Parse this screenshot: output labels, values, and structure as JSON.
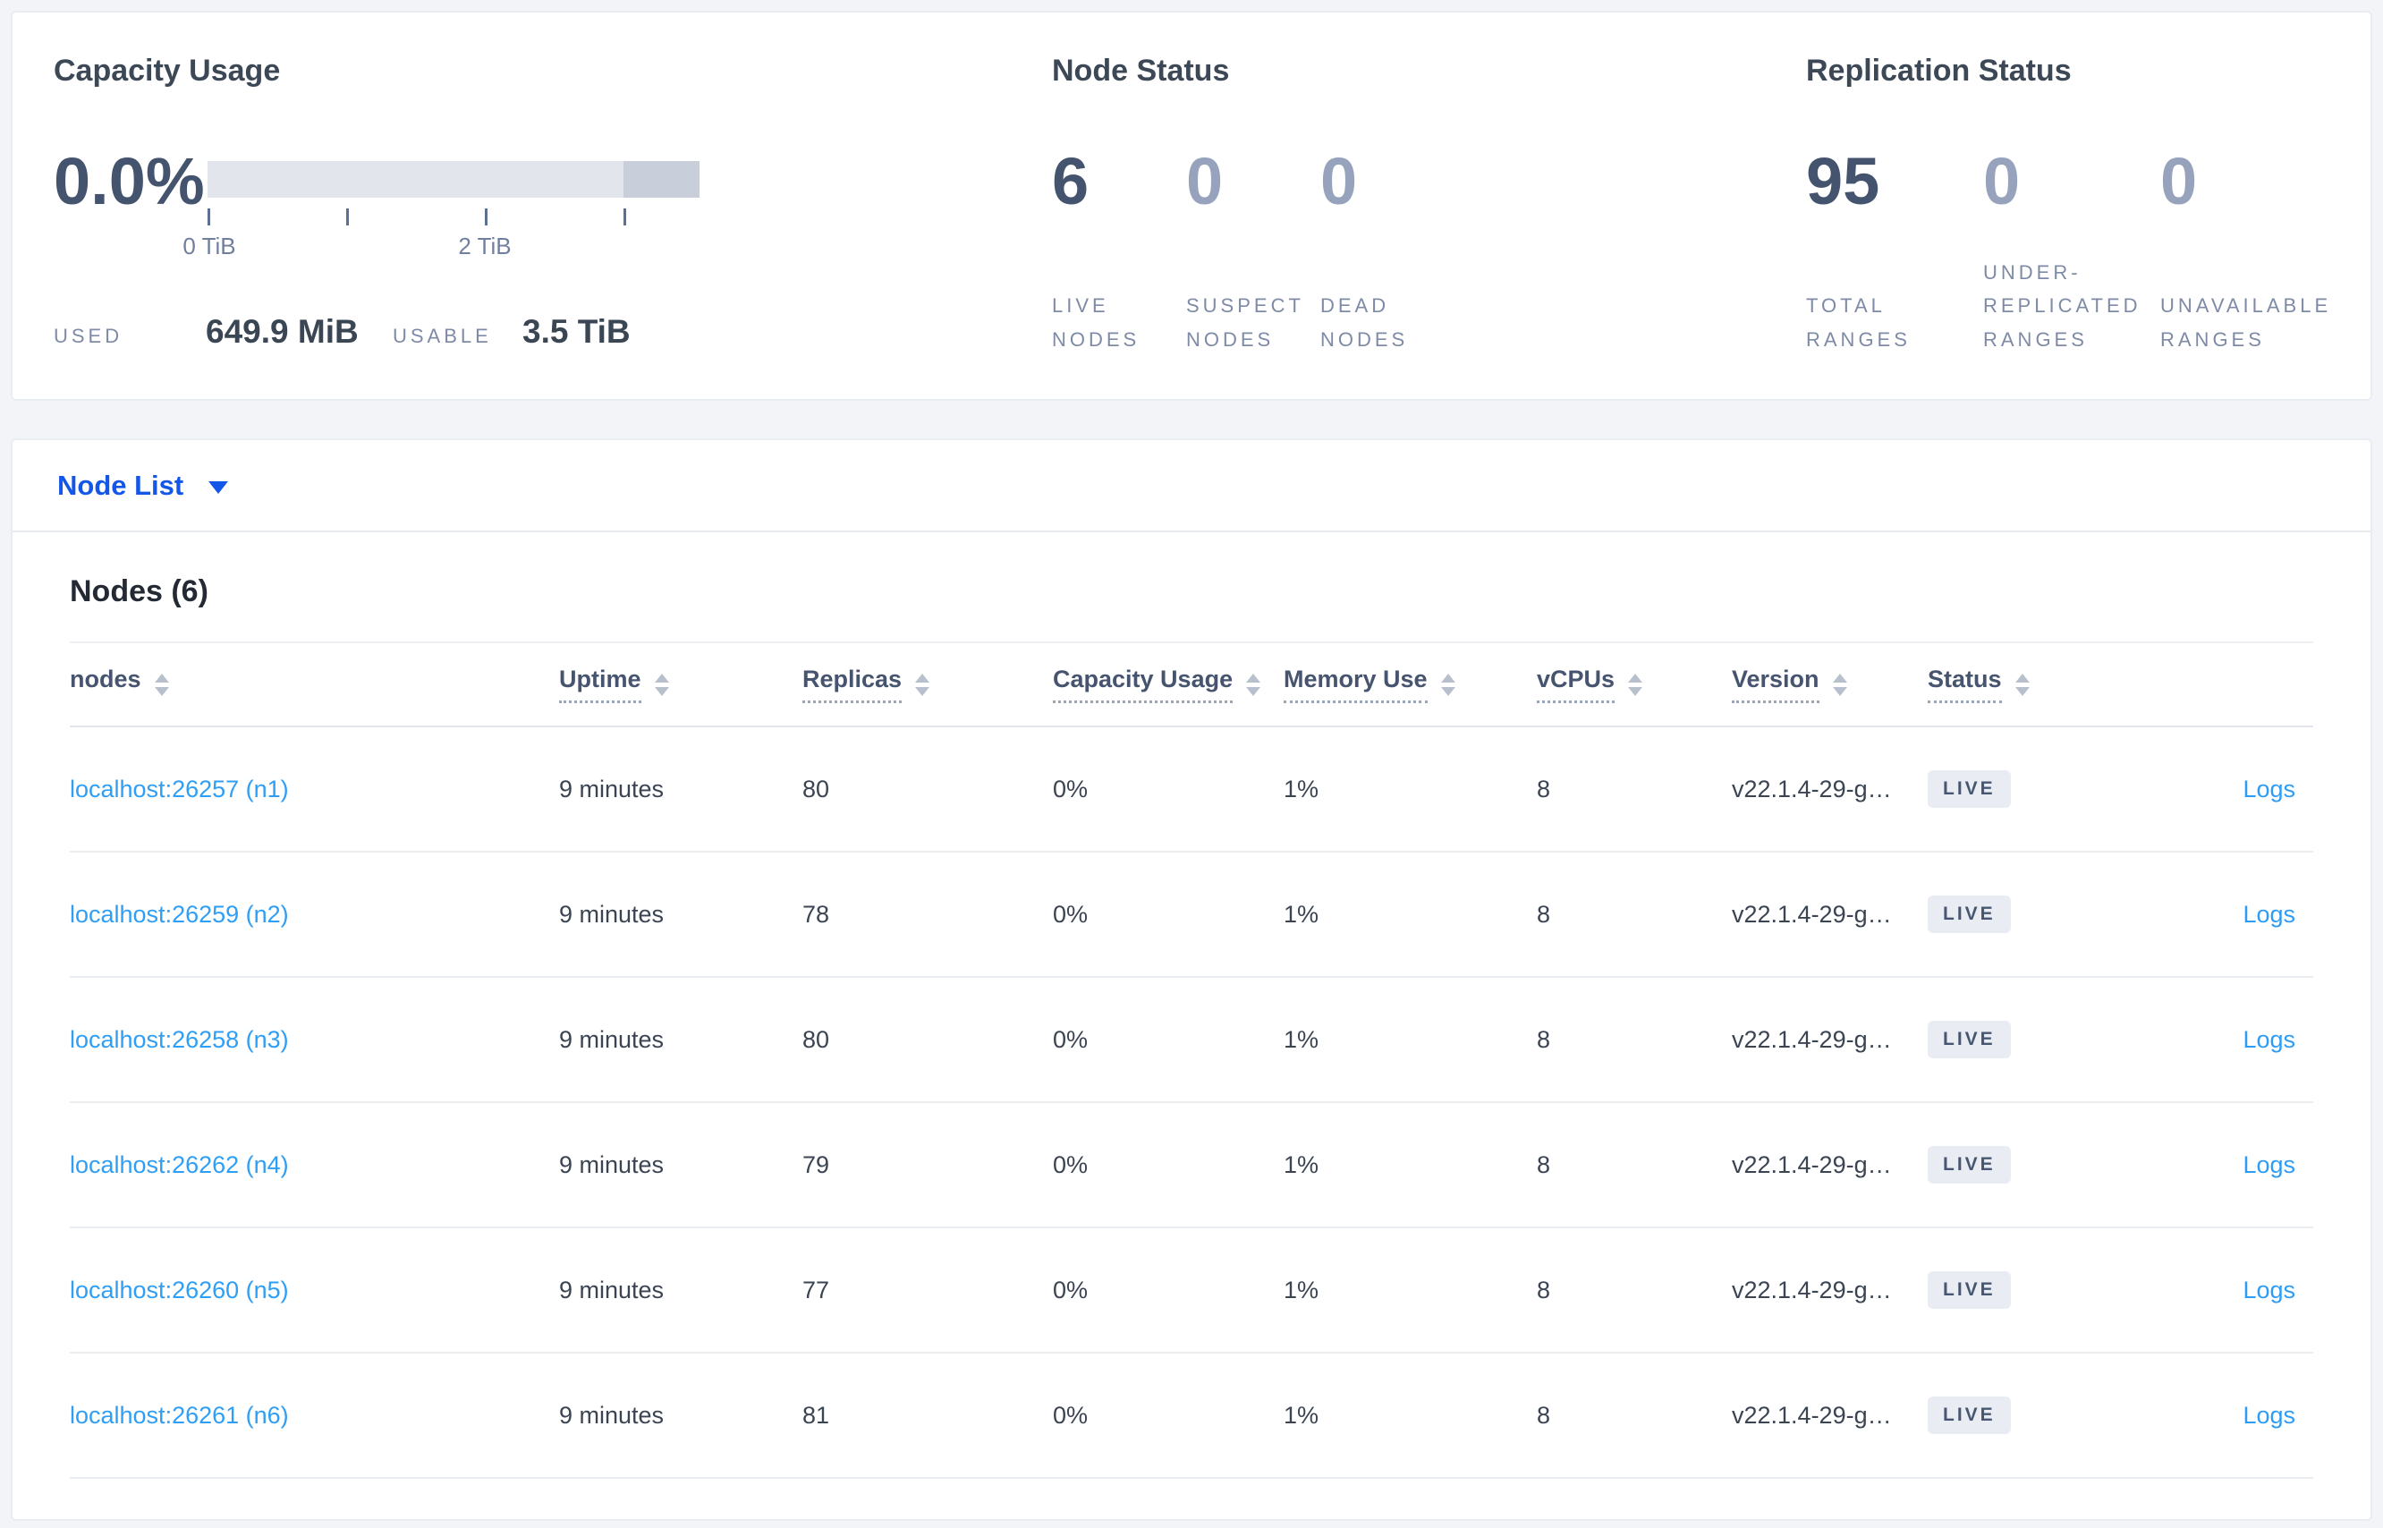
{
  "summary": {
    "capacity": {
      "title": "Capacity Usage",
      "percent": "0.0%",
      "used_label": "USED",
      "used_value": "649.9 MiB",
      "usable_label": "USABLE",
      "usable_value": "3.5 TiB",
      "bar": {
        "tick_labels": [
          "0 TiB",
          "2 TiB"
        ],
        "axis_max": "3.5 TiB",
        "light_color": "#e3e5ec",
        "dark_color": "#c9cedb"
      }
    },
    "node_status": {
      "title": "Node Status",
      "stats": [
        {
          "value": "6",
          "label": "LIVE NODES"
        },
        {
          "value": "0",
          "label": "SUSPECT NODES"
        },
        {
          "value": "0",
          "label": "DEAD NODES"
        }
      ]
    },
    "replication": {
      "title": "Replication Status",
      "stats": [
        {
          "value": "95",
          "label": "TOTAL RANGES"
        },
        {
          "value": "0",
          "label": "UNDER-REPLICATED RANGES"
        },
        {
          "value": "0",
          "label": "UNAVAILABLE RANGES"
        }
      ]
    }
  },
  "node_list": {
    "dropdown_label": "Node List",
    "heading": "Nodes (6)",
    "columns": [
      {
        "label": "nodes",
        "underline": false
      },
      {
        "label": "Uptime",
        "underline": true
      },
      {
        "label": "Replicas",
        "underline": true
      },
      {
        "label": "Capacity Usage",
        "underline": true
      },
      {
        "label": "Memory Use",
        "underline": true
      },
      {
        "label": "vCPUs",
        "underline": true
      },
      {
        "label": "Version",
        "underline": true
      },
      {
        "label": "Status",
        "underline": true
      },
      {
        "label": "",
        "underline": false
      }
    ],
    "rows": [
      {
        "node": "localhost:26257 (n1)",
        "uptime": "9 minutes",
        "replicas": "80",
        "capacity": "0%",
        "memory": "1%",
        "vcpus": "8",
        "version": "v22.1.4-29-g…",
        "status": "LIVE",
        "logs": "Logs"
      },
      {
        "node": "localhost:26259 (n2)",
        "uptime": "9 minutes",
        "replicas": "78",
        "capacity": "0%",
        "memory": "1%",
        "vcpus": "8",
        "version": "v22.1.4-29-g…",
        "status": "LIVE",
        "logs": "Logs"
      },
      {
        "node": "localhost:26258 (n3)",
        "uptime": "9 minutes",
        "replicas": "80",
        "capacity": "0%",
        "memory": "1%",
        "vcpus": "8",
        "version": "v22.1.4-29-g…",
        "status": "LIVE",
        "logs": "Logs"
      },
      {
        "node": "localhost:26262 (n4)",
        "uptime": "9 minutes",
        "replicas": "79",
        "capacity": "0%",
        "memory": "1%",
        "vcpus": "8",
        "version": "v22.1.4-29-g…",
        "status": "LIVE",
        "logs": "Logs"
      },
      {
        "node": "localhost:26260 (n5)",
        "uptime": "9 minutes",
        "replicas": "77",
        "capacity": "0%",
        "memory": "1%",
        "vcpus": "8",
        "version": "v22.1.4-29-g…",
        "status": "LIVE",
        "logs": "Logs"
      },
      {
        "node": "localhost:26261 (n6)",
        "uptime": "9 minutes",
        "replicas": "81",
        "capacity": "0%",
        "memory": "1%",
        "vcpus": "8",
        "version": "v22.1.4-29-g…",
        "status": "LIVE",
        "logs": "Logs"
      }
    ]
  },
  "colors": {
    "page_background": "#f2f4f8",
    "dropdown_blue": "#1457e8",
    "link_blue": "#2f9ef5",
    "dark_number": "#44536e",
    "muted_number": "#97a3bd",
    "badge_background": "#e9edf3",
    "badge_text": "#475771"
  }
}
